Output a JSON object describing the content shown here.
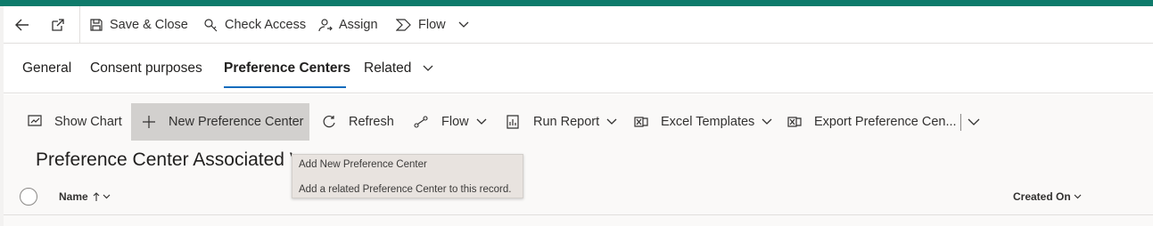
{
  "command_bar": {
    "save_close": "Save & Close",
    "check_access": "Check Access",
    "assign": "Assign",
    "flow": "Flow"
  },
  "tabs": [
    {
      "label": "General"
    },
    {
      "label": "Consent purposes"
    },
    {
      "label": "Preference Centers",
      "active": true
    },
    {
      "label": "Related"
    }
  ],
  "subgrid": {
    "show_chart": "Show Chart",
    "new_preference_center": "New Preference Center",
    "refresh": "Refresh",
    "flow": "Flow",
    "run_report": "Run Report",
    "excel_templates": "Excel Templates",
    "export": "Export Preference Cen...",
    "title": "Preference Center Associated Vi",
    "columns": {
      "name": "Name",
      "created_on": "Created On"
    }
  },
  "tooltip": {
    "title": "Add New Preference Center",
    "description": "Add a related Preference Center to this record."
  },
  "colors": {
    "accent_bar": "#0e7b6b",
    "tab_underline": "#0f6cbd",
    "button_hover": "#d2d0ce",
    "tooltip_bg": "#e8e3df"
  }
}
